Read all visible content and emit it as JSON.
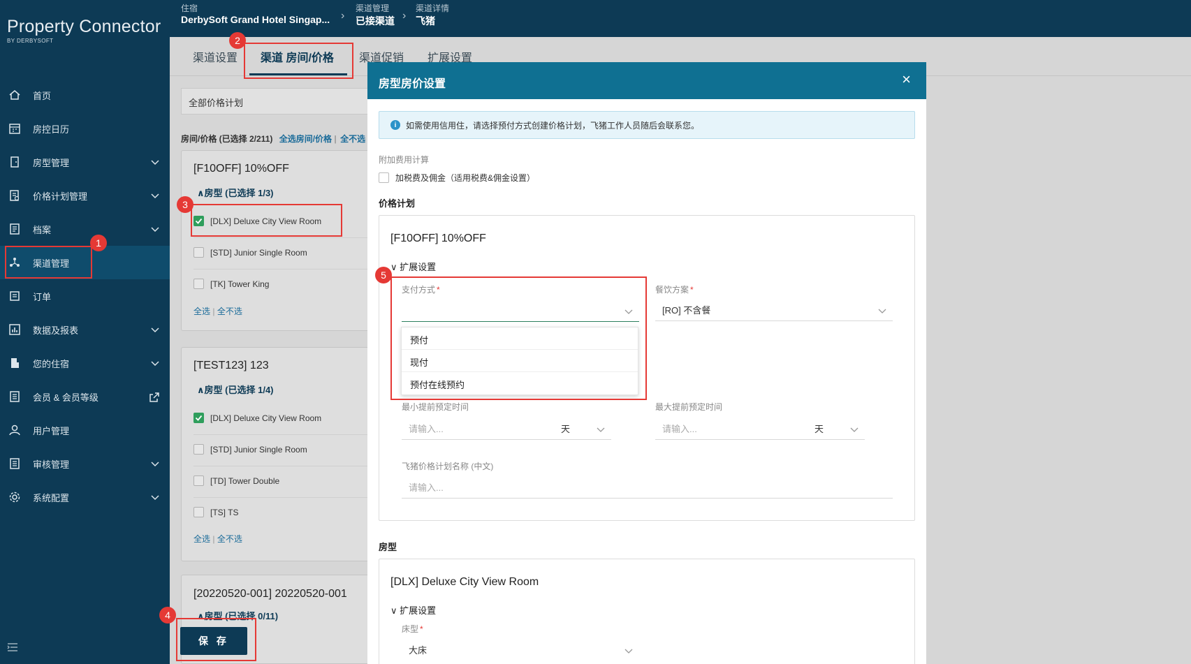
{
  "app": {
    "logo": "Property Connector",
    "logo_sub": "BY DERBYSOFT"
  },
  "sidebar": {
    "items": [
      {
        "label": "首页",
        "icon": "home-icon"
      },
      {
        "label": "房控日历",
        "icon": "calendar-icon"
      },
      {
        "label": "房型管理",
        "icon": "door-icon"
      },
      {
        "label": "价格计划管理",
        "icon": "price-plan-icon"
      },
      {
        "label": "档案",
        "icon": "document-icon"
      },
      {
        "label": "渠道管理",
        "icon": "channel-icon"
      },
      {
        "label": "订单",
        "icon": "order-icon"
      },
      {
        "label": "数据及报表",
        "icon": "report-icon"
      },
      {
        "label": "您的住宿",
        "icon": "building-icon"
      },
      {
        "label": "会员 & 会员等级",
        "icon": "member-icon"
      },
      {
        "label": "用户管理",
        "icon": "user-icon"
      },
      {
        "label": "审核管理",
        "icon": "audit-icon"
      },
      {
        "label": "系统配置",
        "icon": "settings-icon"
      }
    ]
  },
  "breadcrumb": {
    "hotel_label": "住宿",
    "hotel_value": "DerbySoft Grand Hotel Singap...",
    "channel_label": "渠道管理",
    "channel_value": "已接渠道",
    "detail_label": "渠道详情",
    "detail_value": "飞猪"
  },
  "tabs": [
    "渠道设置",
    "渠道 房间/价格",
    "渠道促销",
    "扩展设置"
  ],
  "filter": {
    "value": "全部价格计划"
  },
  "summary": {
    "text": "房间/价格 (已选择 2/211)",
    "select_all": "全选房间/价格",
    "deselect": "全不选"
  },
  "cards": [
    {
      "title": "[F10OFF] 10%OFF",
      "sub": "∧房型 (已选择 1/3)",
      "rooms": [
        "[DLX] Deluxe City View Room",
        "[STD] Junior Single Room",
        "[TK] Tower King"
      ],
      "checked": [
        true,
        false,
        false
      ]
    },
    {
      "title": "[TEST123] 123",
      "sub": "∧房型 (已选择 1/4)",
      "rooms": [
        "[DLX] Deluxe City View Room",
        "[STD] Junior Single Room",
        "[TD] Tower Double",
        "[TS] TS"
      ],
      "checked": [
        true,
        false,
        false,
        false
      ]
    },
    {
      "title": "[20220520-001] 20220520-001",
      "sub": "∧房型 (已选择 0/11)"
    }
  ],
  "card_links": {
    "all": "全选",
    "none": "全不选"
  },
  "save_label": "保 存",
  "badges": [
    "1",
    "2",
    "3",
    "4",
    "5"
  ],
  "modal": {
    "title": "房型房价设置",
    "close": "×",
    "info": "如需使用信用住，请选择预付方式创建价格计划，飞猪工作人员随后会联系您。",
    "fee_label": "附加费用计算",
    "fee_checkbox": "加税费及佣金（适用税费&佣金设置）",
    "rate_section": "价格计划",
    "rate_title": "[F10OFF] 10%OFF",
    "expand": "扩展设置",
    "payment_label": "支付方式",
    "meal_label": "餐饮方案",
    "meal_value": "[RO] 不含餐",
    "payment_options": [
      "预付",
      "现付",
      "预付在线预约"
    ],
    "min_label": "最小提前预定时间",
    "max_label": "最大提前预定时间",
    "placeholder": "请输入...",
    "unit": "天",
    "name_label": "飞猪价格计划名称 (中文)",
    "room_section": "房型",
    "room_title": "[DLX] Deluxe City View Room",
    "bed_label": "床型",
    "bed_value": "大床"
  },
  "colors": {
    "sidebar": "#0d3a55",
    "modal_header": "#0f7092",
    "marker": "#e53935",
    "checkbox": "#2f9e5c"
  }
}
